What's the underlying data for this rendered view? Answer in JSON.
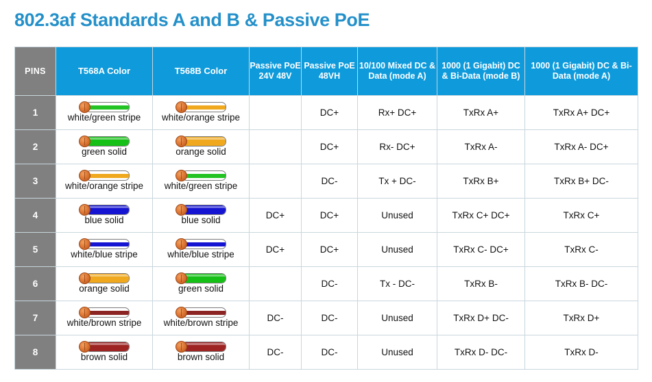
{
  "title": "802.3af Standards A and B & Passive PoE",
  "colors": {
    "title": "#2490c9",
    "header_blue": "#0f9bdb",
    "pins_gray": "#808080",
    "grid": "#c9d6dd"
  },
  "table": {
    "headers": [
      "PINS",
      "T568A Color",
      "T568B Color",
      "Passive PoE 24V 48V",
      "Passive PoE 48VH",
      "10/100 Mixed DC & Data (mode A)",
      "1000 (1 Gigabit) DC & Bi-Data (mode B)",
      "1000 (1 Gigabit) DC & Bi-Data (mode A)"
    ],
    "rows": [
      {
        "pin": "1",
        "a_label": "white/green stripe",
        "a_style": "stripe",
        "a_color": "#22c322",
        "b_label": "white/orange stripe",
        "b_style": "stripe",
        "b_color": "#f0a81e",
        "p24": "",
        "p48": "DC+",
        "mixed": "Rx+  DC+",
        "gigb": "TxRx A+",
        "giga": "TxRx A+  DC+"
      },
      {
        "pin": "2",
        "a_label": "green solid",
        "a_style": "solid",
        "a_color": "#16c016",
        "b_label": "orange solid",
        "b_style": "solid",
        "b_color": "#f0a81e",
        "p24": "",
        "p48": "DC+",
        "mixed": "Rx-  DC+",
        "gigb": "TxRx A-",
        "giga": "TxRx A-  DC+"
      },
      {
        "pin": "3",
        "a_label": "white/orange stripe",
        "a_style": "stripe",
        "a_color": "#f0a81e",
        "b_label": "white/green stripe",
        "b_style": "stripe",
        "b_color": "#22c322",
        "p24": "",
        "p48": "DC-",
        "mixed": "Tx +  DC-",
        "gigb": "TxRx B+",
        "giga": "TxRx B+  DC-"
      },
      {
        "pin": "4",
        "a_label": "blue solid",
        "a_style": "solid",
        "a_color": "#1414d2",
        "b_label": "blue solid",
        "b_style": "solid",
        "b_color": "#1414d2",
        "p24": "DC+",
        "p48": "DC+",
        "mixed": "Unused",
        "gigb": "TxRx C+  DC+",
        "giga": "TxRx C+"
      },
      {
        "pin": "5",
        "a_label": "white/blue stripe",
        "a_style": "stripe",
        "a_color": "#1414d2",
        "b_label": "white/blue stripe",
        "b_style": "stripe",
        "b_color": "#1414d2",
        "p24": "DC+",
        "p48": "DC+",
        "mixed": "Unused",
        "gigb": "TxRx C-  DC+",
        "giga": "TxRx C-"
      },
      {
        "pin": "6",
        "a_label": "orange solid",
        "a_style": "solid",
        "a_color": "#f0a81e",
        "b_label": "green solid",
        "b_style": "solid",
        "b_color": "#16c016",
        "p24": "",
        "p48": "DC-",
        "mixed": "Tx -  DC-",
        "gigb": "TxRx B-",
        "giga": "TxRx B-  DC-"
      },
      {
        "pin": "7",
        "a_label": "white/brown stripe",
        "a_style": "stripe",
        "a_color": "#8d2424",
        "b_label": "white/brown stripe",
        "b_style": "stripe",
        "b_color": "#8d2424",
        "p24": "DC-",
        "p48": "DC-",
        "mixed": "Unused",
        "gigb": "TxRx D+  DC-",
        "giga": "TxRx D+"
      },
      {
        "pin": "8",
        "a_label": "brown solid",
        "a_style": "solid",
        "a_color": "#9e2424",
        "b_label": "brown solid",
        "b_style": "solid",
        "b_color": "#9e2424",
        "p24": "DC-",
        "p48": "DC-",
        "mixed": "Unused",
        "gigb": "TxRx D-  DC-",
        "giga": "TxRx D-"
      }
    ]
  }
}
